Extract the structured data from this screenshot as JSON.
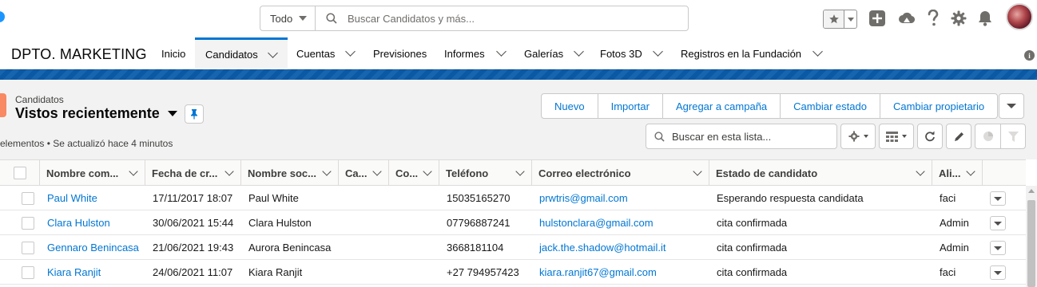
{
  "global_header": {
    "search_scope": "Todo",
    "search_placeholder": "Buscar Candidatos y más...",
    "icons": [
      "favorites-star-icon",
      "favorites-dropdown-icon",
      "global-add-icon",
      "trailhead-icon",
      "help-icon",
      "setup-gear-icon",
      "notifications-bell-icon",
      "avatar"
    ]
  },
  "app_nav": {
    "app_name": "DPTO. MARKETING",
    "items": [
      {
        "label": "Inicio",
        "has_menu": false,
        "active": false
      },
      {
        "label": "Candidatos",
        "has_menu": true,
        "active": true
      },
      {
        "label": "Cuentas",
        "has_menu": true,
        "active": false
      },
      {
        "label": "Previsiones",
        "has_menu": false,
        "active": false
      },
      {
        "label": "Informes",
        "has_menu": true,
        "active": false
      },
      {
        "label": "Galerías",
        "has_menu": true,
        "active": false
      },
      {
        "label": "Fotos 3D",
        "has_menu": true,
        "active": false
      },
      {
        "label": "Registros en la Fundación",
        "has_menu": true,
        "active": false
      }
    ],
    "info_glyph": "i"
  },
  "list_header": {
    "object_label": "Candidatos",
    "view_name": "Vistos recientemente",
    "meta": "elementos • Se actualizó hace 4 minutos",
    "actions": [
      "Nuevo",
      "Importar",
      "Agregar a campaña",
      "Cambiar estado",
      "Cambiar propietario"
    ],
    "search_placeholder": "Buscar en esta lista..."
  },
  "table": {
    "columns": [
      "Nombre com...",
      "Fecha de cr...",
      "Nombre soc...",
      "Ca...",
      "Co...",
      "Teléfono",
      "Correo electrónico",
      "Estado de candidato",
      "Ali..."
    ],
    "rows": [
      {
        "nombre": "Paul White",
        "fecha": "17/11/2017 18:07",
        "socio": "Paul White",
        "ca": "",
        "co": "",
        "telefono": "15035165270",
        "correo": "prwtris@gmail.com",
        "estado": "Esperando respuesta candidata",
        "alias": "faci"
      },
      {
        "nombre": "Clara Hulston",
        "fecha": "30/06/2021 15:44",
        "socio": "Clara Hulston",
        "ca": "",
        "co": "",
        "telefono": "07796887241",
        "correo": "hulstonclara@gmail.com",
        "estado": "cita confirmada",
        "alias": "Admin"
      },
      {
        "nombre": "Gennaro Benincasa",
        "fecha": "21/06/2021 19:43",
        "socio": "Aurora Benincasa",
        "ca": "",
        "co": "",
        "telefono": "3668181104",
        "correo": "jack.the.shadow@hotmail.it",
        "estado": "cita confirmada",
        "alias": "Admin"
      },
      {
        "nombre": "Kiara Ranjit",
        "fecha": "24/06/2021 11:07",
        "socio": "Kiara Ranjit",
        "ca": "",
        "co": "",
        "telefono": "+27 794957423",
        "correo": "kiara.ranjit67@gmail.com",
        "estado": "cita confirmada",
        "alias": "faci"
      }
    ]
  },
  "colors": {
    "brand": "#0176d3",
    "band": "#0b5cab",
    "link": "#0176d3"
  }
}
